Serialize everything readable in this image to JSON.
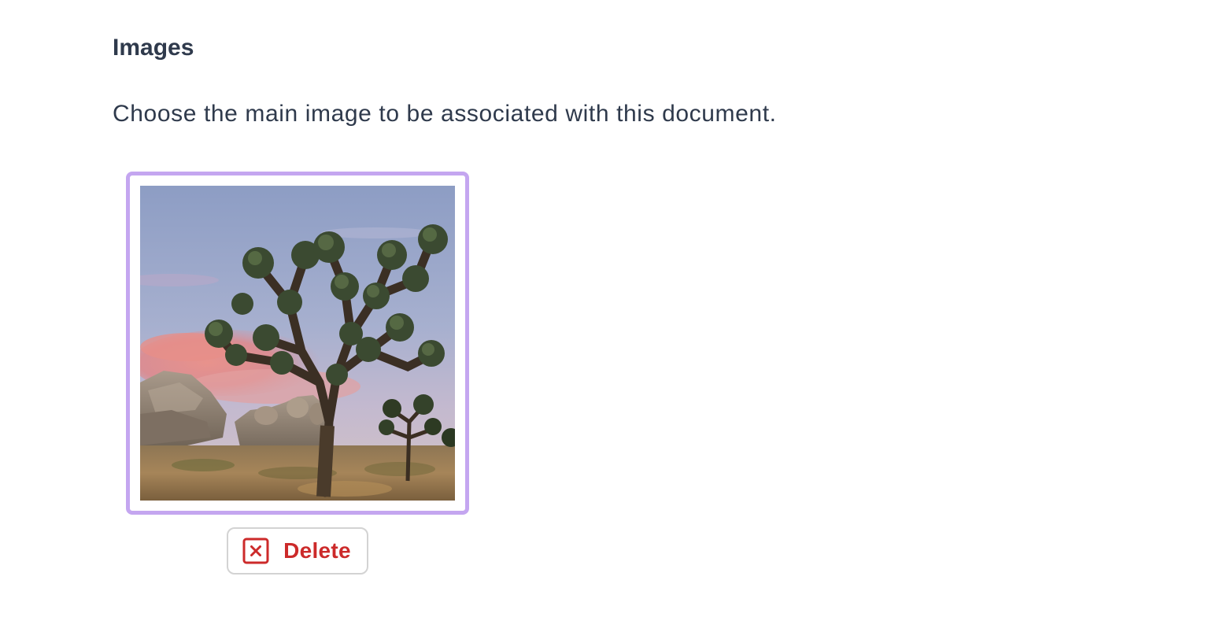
{
  "section": {
    "title": "Images",
    "description": "Choose the main image to be associated with this document."
  },
  "image": {
    "selected": true,
    "alt": "Joshua tree in the desert with rocks at sunset"
  },
  "delete_button": {
    "label": "Delete",
    "icon": "close-square-icon"
  },
  "colors": {
    "text": "#2f3a4c",
    "selection_border": "#c4a6f0",
    "delete_red": "#cc2a2a",
    "button_border": "#d3d3d3"
  }
}
